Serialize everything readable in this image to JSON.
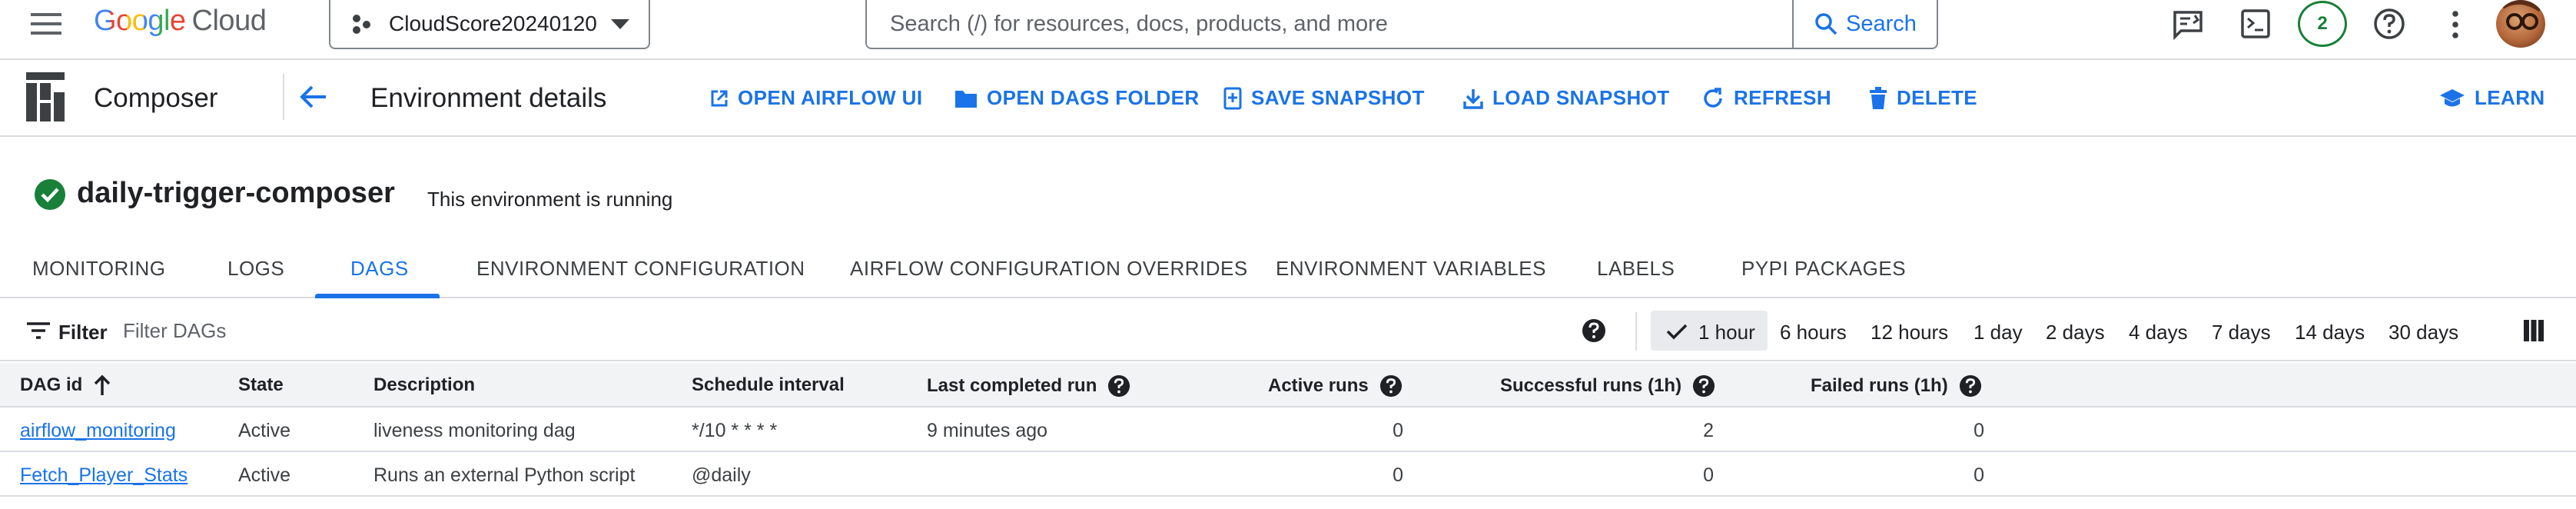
{
  "topbar": {
    "menu_icon": "menu-icon",
    "brand": {
      "google": "Google",
      "cloud": "Cloud"
    },
    "project": "CloudScore20240120",
    "search": {
      "placeholder": "Search (/) for resources, docs, products, and more",
      "button": "Search"
    },
    "notifications_count": "2"
  },
  "subbar": {
    "product": "Composer",
    "title": "Environment details",
    "actions": [
      {
        "label": "OPEN AIRFLOW UI",
        "icon": "open-external-icon"
      },
      {
        "label": "OPEN DAGS FOLDER",
        "icon": "folder-icon"
      },
      {
        "label": "SAVE SNAPSHOT",
        "icon": "save-snapshot-icon"
      },
      {
        "label": "LOAD SNAPSHOT",
        "icon": "download-icon"
      },
      {
        "label": "REFRESH",
        "icon": "refresh-icon"
      },
      {
        "label": "DELETE",
        "icon": "trash-icon"
      }
    ],
    "learn": "LEARN"
  },
  "environment": {
    "name": "daily-trigger-composer",
    "status": "This environment is running"
  },
  "tabs": [
    {
      "label": "MONITORING"
    },
    {
      "label": "LOGS"
    },
    {
      "label": "DAGS"
    },
    {
      "label": "ENVIRONMENT CONFIGURATION"
    },
    {
      "label": "AIRFLOW CONFIGURATION OVERRIDES"
    },
    {
      "label": "ENVIRONMENT VARIABLES"
    },
    {
      "label": "LABELS"
    },
    {
      "label": "PYPI PACKAGES"
    }
  ],
  "active_tab": "DAGS",
  "filter": {
    "label": "Filter",
    "placeholder": "Filter DAGs",
    "time_ranges": [
      "1 hour",
      "6 hours",
      "12 hours",
      "1 day",
      "2 days",
      "4 days",
      "7 days",
      "14 days",
      "30 days"
    ],
    "selected_range": "1 hour"
  },
  "table": {
    "columns": [
      "DAG id",
      "State",
      "Description",
      "Schedule interval",
      "Last completed run",
      "Active runs",
      "Successful runs (1h)",
      "Failed runs (1h)"
    ],
    "rows": [
      {
        "dag_id": "airflow_monitoring",
        "state": "Active",
        "description": "liveness monitoring dag",
        "schedule": "*/10 * * * *",
        "last_run": "9 minutes ago",
        "active": "0",
        "successful": "2",
        "failed": "0"
      },
      {
        "dag_id": "Fetch_Player_Stats",
        "state": "Active",
        "description": "Runs an external Python script",
        "schedule": "@daily",
        "last_run": "",
        "active": "0",
        "successful": "0",
        "failed": "0"
      }
    ]
  },
  "colors": {
    "accent": "#1a73e8",
    "success": "#188038",
    "text": "#202124"
  }
}
